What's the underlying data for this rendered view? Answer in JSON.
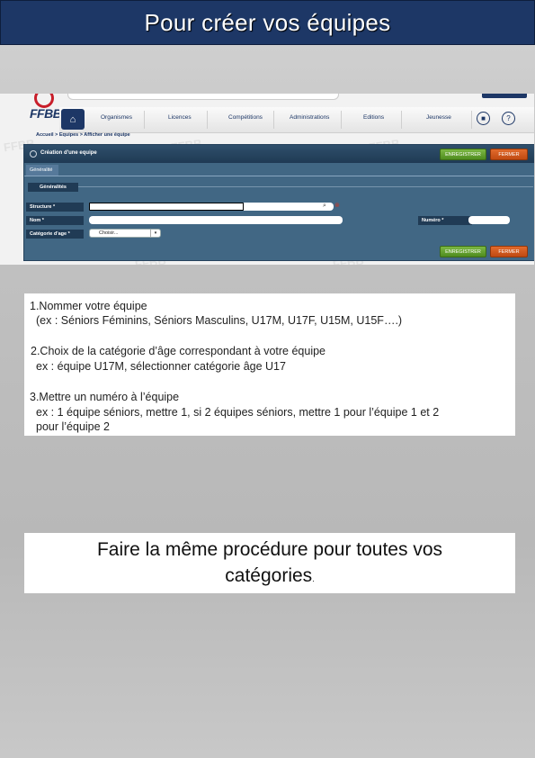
{
  "page": {
    "title": "Pour créer vos équipes"
  },
  "app": {
    "logo": "FFBB",
    "nav": {
      "items": [
        "Organismes",
        "Licences",
        "Compétitions",
        "Administrations",
        "Editions",
        "Jeunesse"
      ]
    },
    "breadcrumb": "Accueil > Equipes > Afficher une équipe",
    "panel": {
      "title": "Création d'une equipe",
      "save_label": "ENREGISTRER",
      "close_label": "FERMER",
      "tab": "Généralité",
      "section": "Généralités",
      "fields": {
        "structure_label": "Structure *",
        "nom_label": "Nom *",
        "categorie_label": "Catégorie d'age *",
        "categorie_value": "Choisir...",
        "numero_label": "Numéro *"
      }
    },
    "colors": {
      "title_bar": "#1d3766",
      "panel": "#416784",
      "save_button": "#5f9e2c",
      "close_button": "#d05a1c"
    }
  },
  "instructions": {
    "step1_title": "1.Nommer votre équipe",
    "step1_example": "(ex : Séniors Féminins, Séniors Masculins, U17M, U17F, U15M, U15F….)",
    "step2_title": "2.Choix de la catégorie d’âge correspondant à votre équipe",
    "step2_example": "ex : équipe U17M, sélectionner catégorie âge U17",
    "step3_title": "3.Mettre un numéro à l’équipe",
    "step3_example_line1": "ex : 1 équipe séniors, mettre 1, si 2 équipes séniors, mettre 1 pour l’équipe 1 et 2",
    "step3_example_line2": "pour l’équipe 2"
  },
  "final_note": {
    "line1": "Faire la même procédure pour toutes vos",
    "line2": "catégories",
    "dot": "."
  }
}
